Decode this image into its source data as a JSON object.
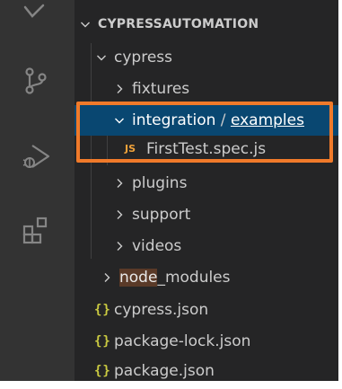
{
  "explorer": {
    "root_label": "CYPRESSAUTOMATION",
    "cypress_folder": "cypress",
    "fixtures_folder": "fixtures",
    "integration_folder": "integration",
    "path_separator": "/",
    "examples_folder": "examples",
    "spec_file_icon": "JS",
    "spec_file": "FirstTest.spec.js",
    "plugins_folder": "plugins",
    "support_folder": "support",
    "videos_folder": "videos",
    "node_modules_prefix": "node",
    "node_modules_suffix": "_modules",
    "json_icon": "{}",
    "cypress_json": "cypress.json",
    "package_lock_json": "package-lock.json",
    "package_json": "package.json"
  },
  "activity_bar": {
    "icons": [
      "explorer-icon",
      "source-control-icon",
      "run-debug-icon",
      "extensions-icon"
    ]
  },
  "colors": {
    "sidebar_bg": "#252526",
    "activity_bar_bg": "#333333",
    "selection_bg": "#094771",
    "highlight_border": "#f07a2a",
    "js_icon": "#f1a23a",
    "json_icon": "#cbcb41"
  }
}
